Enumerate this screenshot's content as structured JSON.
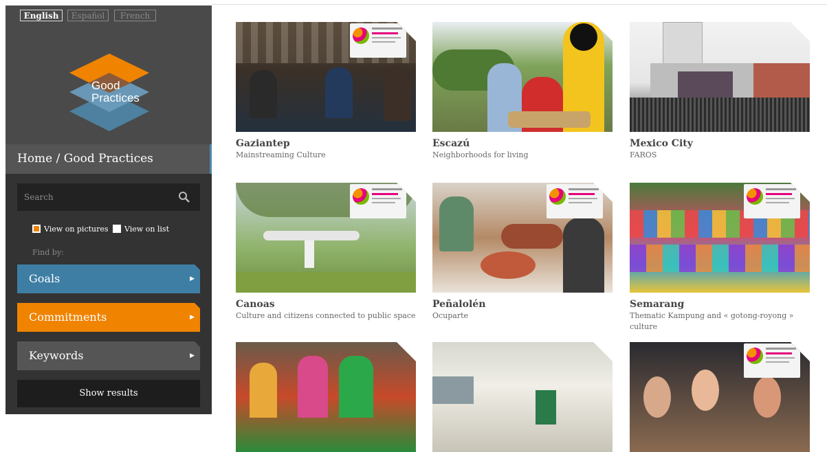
{
  "languages": [
    "English",
    "Español",
    "French"
  ],
  "logo_text": [
    "Good",
    "Practices"
  ],
  "breadcrumb": "Home / Good Practices",
  "search": {
    "placeholder": "Search"
  },
  "view_options": {
    "pictures": "View on pictures",
    "list": "View on list"
  },
  "find_by": "Find by:",
  "filters": [
    {
      "label": "Goals",
      "color": "#3e7ea4"
    },
    {
      "label": "Commitments",
      "color": "#f08300"
    },
    {
      "label": "Keywords",
      "color": "#555555"
    }
  ],
  "show_results": "Show results",
  "cards": [
    {
      "city": "Gaziantep",
      "subtitle": "Mainstreaming Culture"
    },
    {
      "city": "Escazú",
      "subtitle": "Neighborhoods for living"
    },
    {
      "city": "Mexico City",
      "subtitle": "FAROS"
    },
    {
      "city": "Canoas",
      "subtitle": "Culture and citizens connected to public space"
    },
    {
      "city": "Peñalolén",
      "subtitle": "Ocuparte"
    },
    {
      "city": "Semarang",
      "subtitle": "Thematic Kampung and « gotong-royong » culture"
    }
  ],
  "colors": {
    "accent_blue": "#3e7ea4",
    "accent_orange": "#f08300",
    "sidebar_bg": "#333333"
  }
}
